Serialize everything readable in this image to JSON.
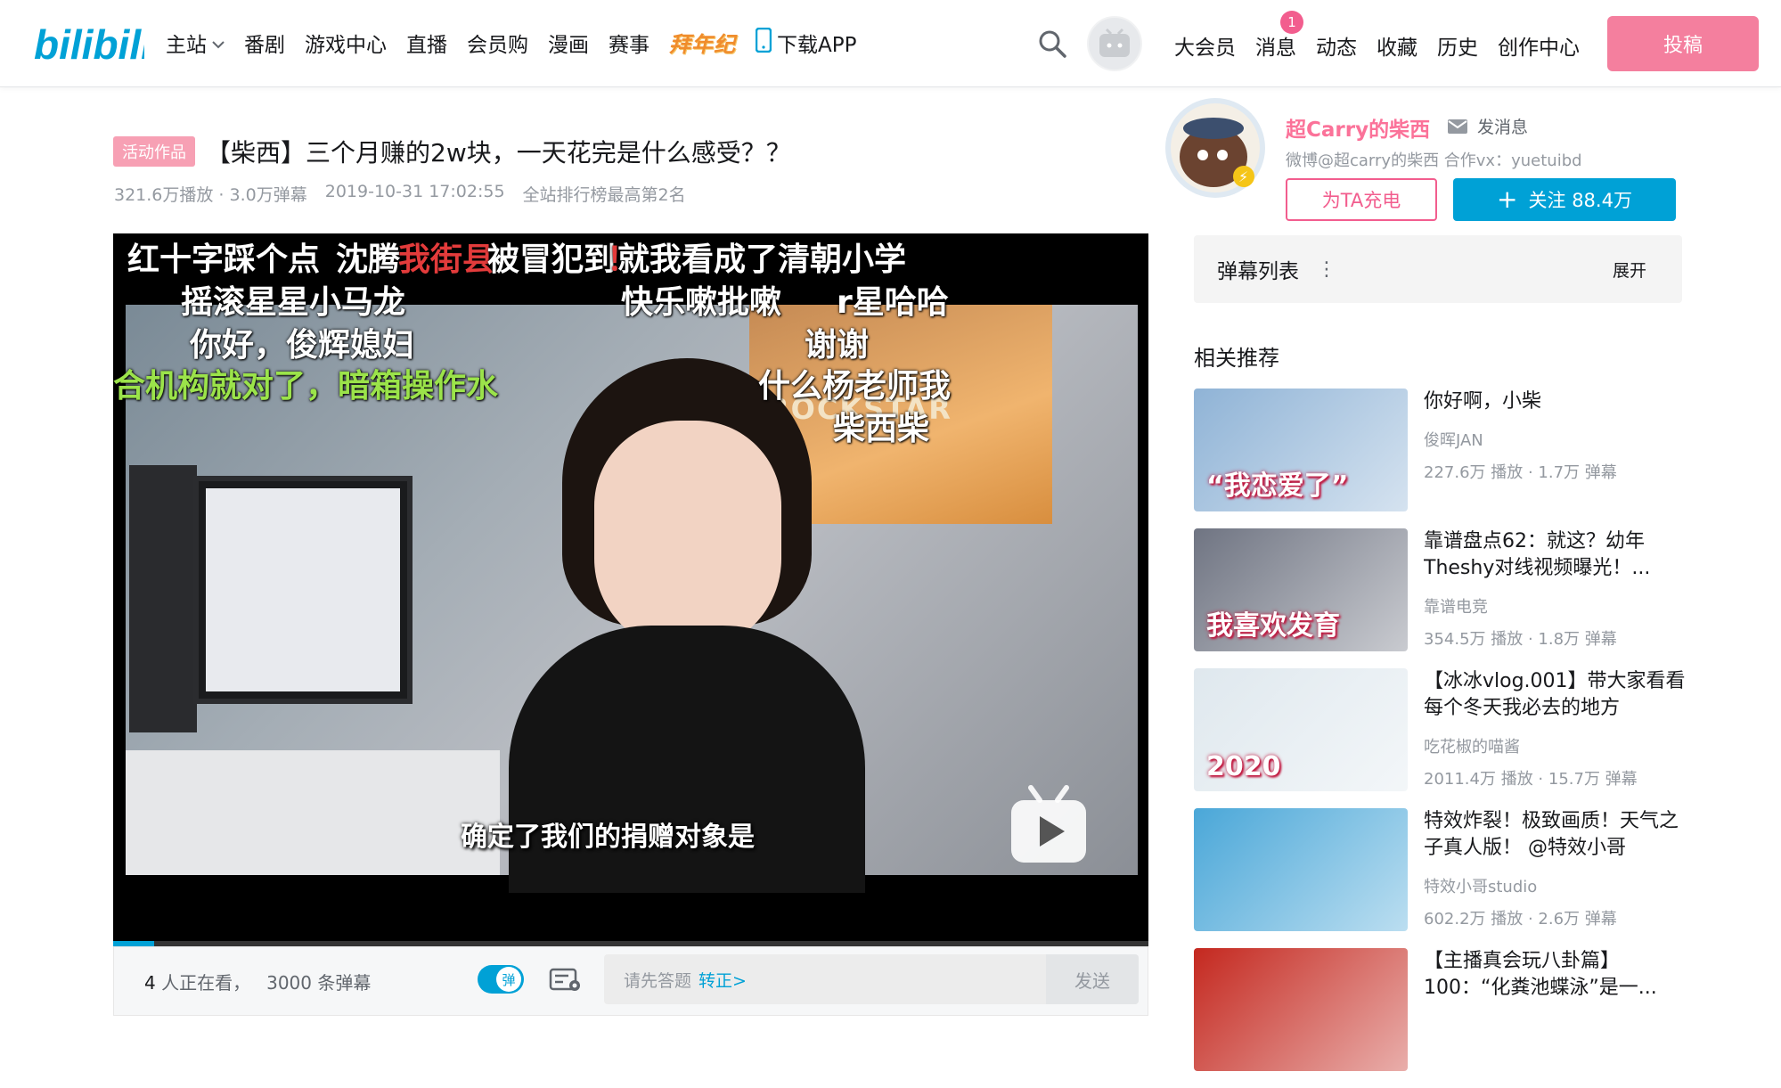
{
  "header": {
    "logo_text": "bilibili",
    "nav": [
      {
        "label": "主站",
        "has_dropdown": true
      },
      {
        "label": "番剧"
      },
      {
        "label": "游戏中心"
      },
      {
        "label": "直播"
      },
      {
        "label": "会员购"
      },
      {
        "label": "漫画"
      },
      {
        "label": "赛事"
      },
      {
        "label": "拜年纪",
        "special": true
      },
      {
        "label": "下载APP",
        "icon": "phone-icon"
      }
    ],
    "right_nav": [
      {
        "label": "大会员"
      },
      {
        "label": "消息",
        "badge": "1"
      },
      {
        "label": "动态"
      },
      {
        "label": "收藏"
      },
      {
        "label": "历史"
      },
      {
        "label": "创作中心"
      }
    ],
    "upload_label": "投稿"
  },
  "video": {
    "tag": "活动作品",
    "title": "【柴西】三个月赚的2w块，一天花完是什么感受？？",
    "plays": "321.6万播放 · 3.0万弹幕",
    "date": "2019-10-31 17:02:55",
    "rank": "全站排行榜最高第2名",
    "subtitle": "确定了我们的捐赠对象是",
    "poster_text": "ROCKSTAR",
    "progress": 0.04,
    "danmaku": [
      {
        "text": "红十字踩个点",
        "color": "#ffffff"
      },
      {
        "text": "沈腾",
        "color": "#ffffff"
      },
      {
        "text": "我街县",
        "color": "#e33b3b"
      },
      {
        "text": "被冒犯到",
        "color": "#ffffff"
      },
      {
        "text": "！",
        "color": "#e33b3b"
      },
      {
        "text": "就我看成了清朝小学",
        "color": "#ffffff"
      },
      {
        "text": "摇滚星星小马龙",
        "color": "#ffffff"
      },
      {
        "text": "快乐嗽批嗽",
        "color": "#ffffff"
      },
      {
        "text": "r星哈哈",
        "color": "#ffffff"
      },
      {
        "text": "你好，俊辉媳妇",
        "color": "#ffffff"
      },
      {
        "text": "谢谢",
        "color": "#ffffff"
      },
      {
        "text": "合机构就对了，暗箱操作水",
        "color": "#9be34a"
      },
      {
        "text": "什么杨老师我",
        "color": "#ffffff"
      },
      {
        "text": "柴西柴",
        "color": "#ffffff"
      }
    ]
  },
  "danmu_bar": {
    "watching_count": "4",
    "watching_suffix": "人正在看，",
    "danmu_count": "3000",
    "danmu_suffix": "条弹幕",
    "toggle_label": "弹",
    "placeholder": "请先答题",
    "link": "转正>",
    "send_label": "发送"
  },
  "uploader": {
    "name": "超Carry的柴西",
    "message_label": "发消息",
    "desc": "微博@超carry的柴西 合作vx：yuetuibd",
    "charge_label": "为TA充电",
    "follow_label": "关注 88.4万"
  },
  "danmu_list": {
    "label": "弹幕列表",
    "expand_label": "展开"
  },
  "recommend": {
    "title": "相关推荐",
    "items": [
      {
        "title": "你好啊，小柴",
        "author": "俊晖JAN",
        "stats": "227.6万 播放 · 1.7万 弹幕",
        "thumb_caption": "“我恋爱了”",
        "thumb_color": "#8fb3d6"
      },
      {
        "title": "靠谱盘点62：就这？幼年Theshy对线视频曝光！...",
        "author": "靠谱电竞",
        "stats": "354.5万 播放 · 1.8万 弹幕",
        "thumb_caption": "我喜欢发育",
        "thumb_color": "#6f7482"
      },
      {
        "title": "【冰冰vlog.001】带大家看看每个冬天我必去的地方",
        "author": "吃花椒的喵酱",
        "stats": "2011.4万 播放 · 15.7万 弹幕",
        "thumb_caption": "2020",
        "thumb_color": "#dfe8ee"
      },
      {
        "title": "特效炸裂！极致画质！天气之子真人版！ @特效小哥",
        "author": "特效小哥studio",
        "stats": "602.2万 播放 · 2.6万 弹幕",
        "thumb_caption": "",
        "thumb_color": "#4aa7d8"
      },
      {
        "title": "【主播真会玩八卦篇】100：“化粪池蝶泳”是一...",
        "author": "",
        "stats": "",
        "thumb_caption": "",
        "thumb_color": "#c4281f"
      }
    ]
  }
}
